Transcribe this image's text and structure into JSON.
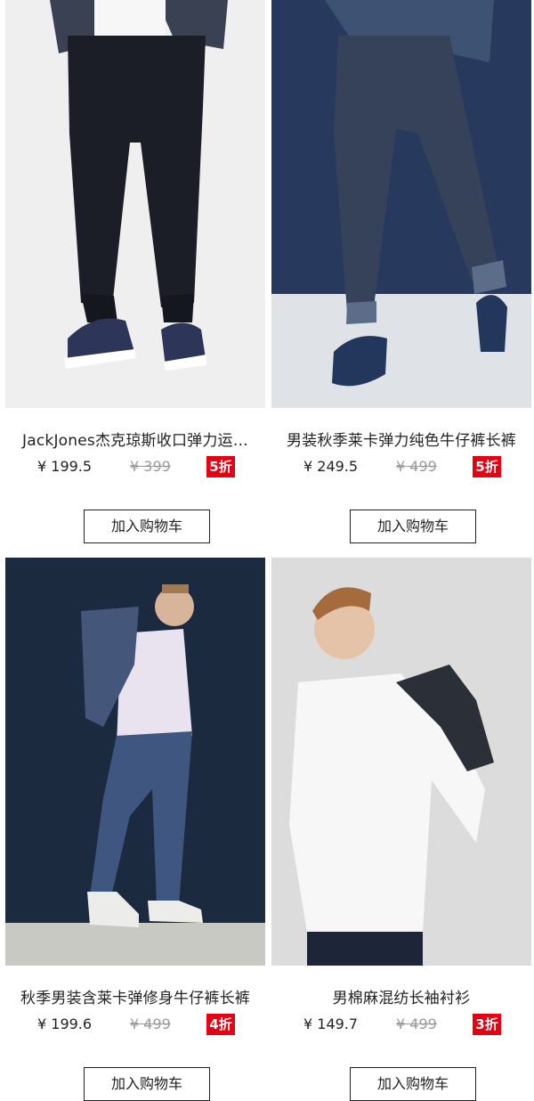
{
  "currency_symbol": "¥",
  "products": [
    {
      "title": "JackJones杰克琼斯收口弹力运…",
      "price": "¥ 199.5",
      "original_price": "¥ 399",
      "discount": "5折",
      "cart_label": "加入购物车"
    },
    {
      "title": "男装秋季莱卡弹力纯色牛仔裤长裤",
      "price": "¥ 249.5",
      "original_price": "¥ 499",
      "discount": "5折",
      "cart_label": "加入购物车"
    },
    {
      "title": "秋季男装含莱卡弹修身牛仔裤长裤",
      "price": "¥ 199.6",
      "original_price": "¥ 499",
      "discount": "4折",
      "cart_label": "加入购物车"
    },
    {
      "title": "男棉麻混纺长袖衬衫",
      "price": "¥ 149.7",
      "original_price": "¥ 499",
      "discount": "3折",
      "cart_label": "加入购物车"
    }
  ],
  "colors": {
    "badge": "#e60012",
    "strikethrough": "#999999"
  }
}
